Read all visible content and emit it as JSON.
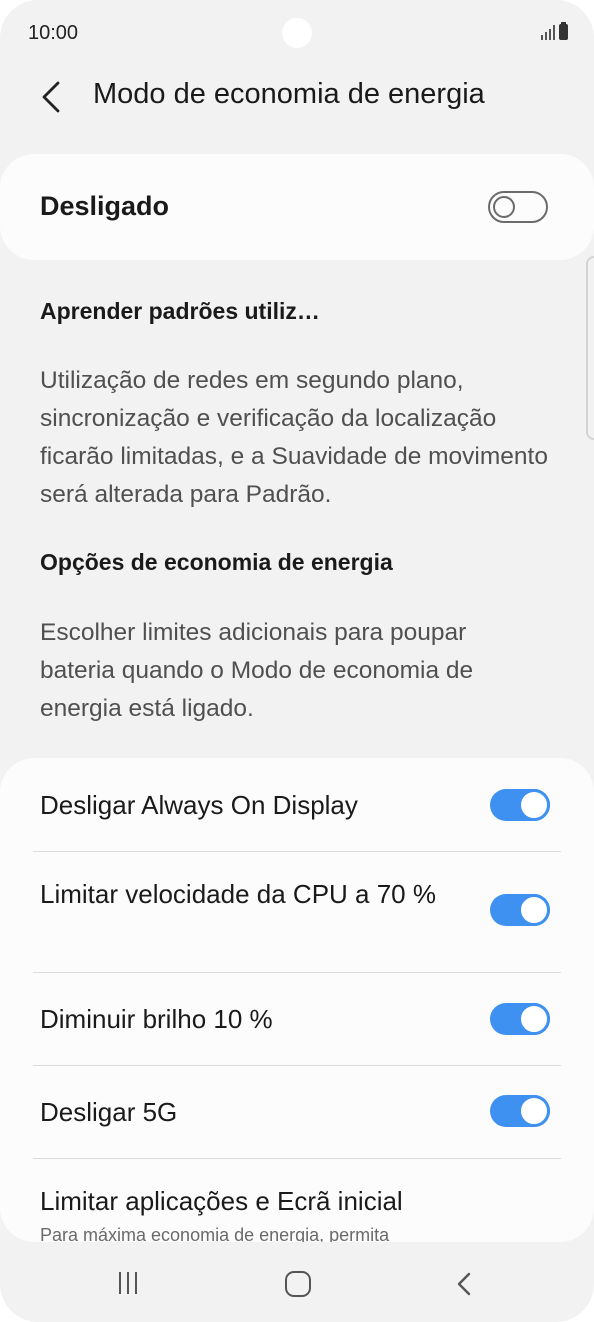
{
  "status_bar": {
    "time": "10:00"
  },
  "header": {
    "title": "Modo de economia de energia",
    "back_icon": "chevron-left-icon"
  },
  "master_switch": {
    "label": "Desligado",
    "state": "off"
  },
  "adaptive": {
    "heading": "Aprender padrões utiliz…",
    "description": "Utilização de redes em segundo plano, sincronização e verificação da localização ficarão limitadas, e a Suavidade de movimento será alterada para Padrão."
  },
  "options_section": {
    "heading": "Opções de economia de energia",
    "description": "Escolher limites adicionais para poupar bateria quando o Modo de economia de energia está ligado."
  },
  "options": [
    {
      "label": "Desligar Always On Display",
      "state": "on"
    },
    {
      "label": "Limitar velocidade da CPU a 70 %",
      "state": "on"
    },
    {
      "label": "Diminuir brilho 10 %",
      "state": "on"
    },
    {
      "label": "Desligar 5G",
      "state": "on"
    },
    {
      "label": "Limitar aplicações e Ecrã inicial",
      "sublabel": "Para máxima economia de energia, permita"
    }
  ],
  "colors": {
    "accent": "#3e91f0",
    "background": "#f2f2f2",
    "card": "#fcfcfc"
  },
  "nav_bar": {
    "icons": [
      "recents-icon",
      "home-icon",
      "back-icon"
    ]
  }
}
